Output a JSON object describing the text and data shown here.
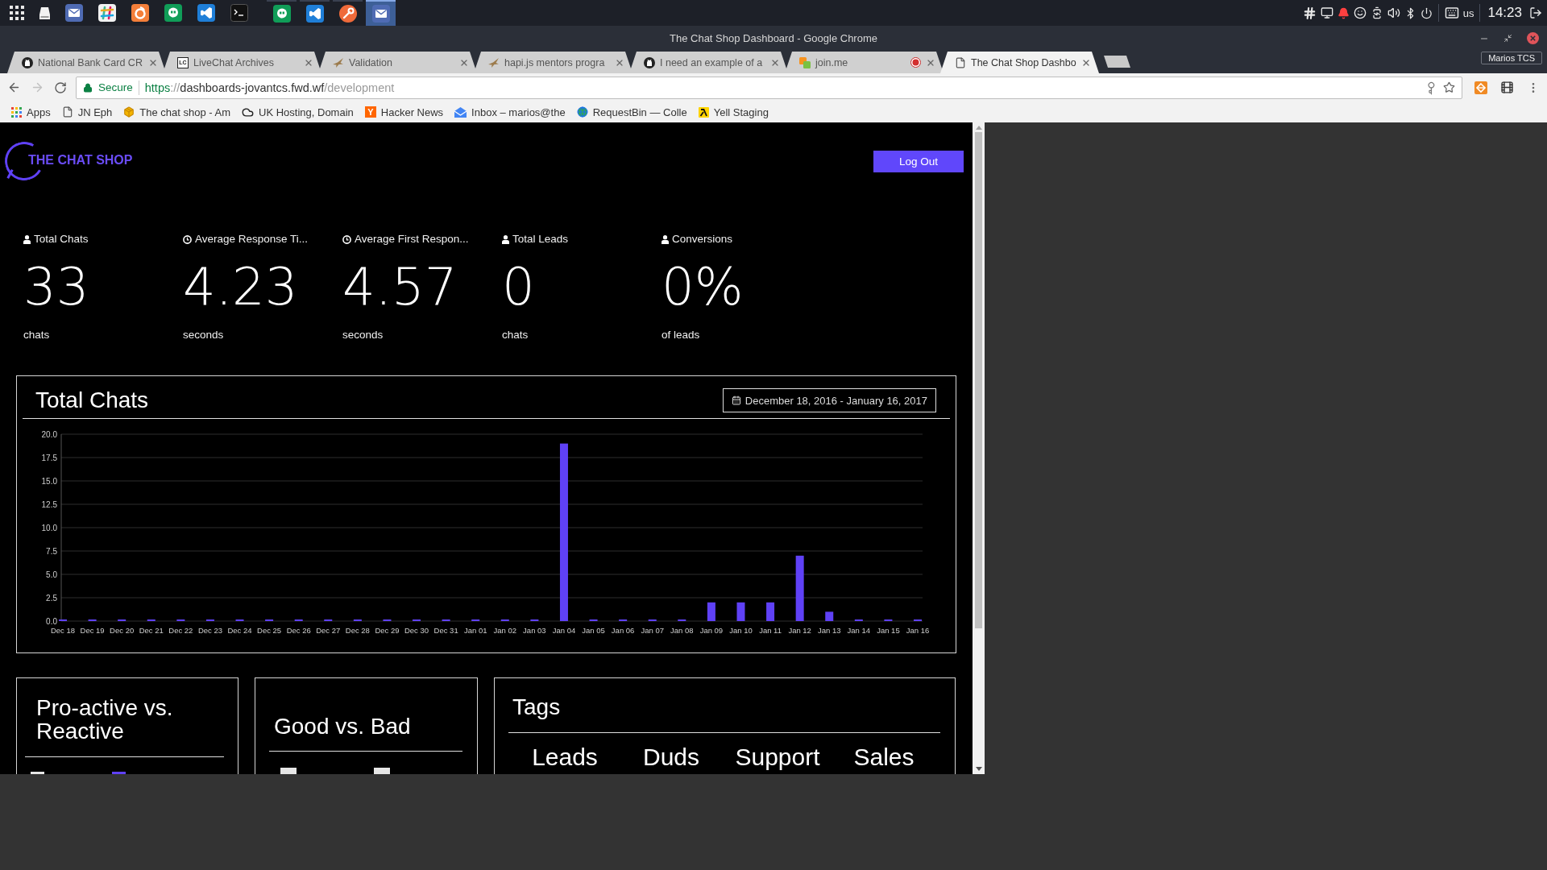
{
  "taskbar": {
    "pinned": [
      {
        "kind": "mail"
      },
      {
        "kind": "hash"
      },
      {
        "kind": "flame"
      },
      {
        "kind": "chat"
      },
      {
        "kind": "code"
      },
      {
        "kind": "terminal"
      }
    ],
    "windows": [
      {
        "kind": "chat",
        "selected": false
      },
      {
        "kind": "code",
        "selected": false
      },
      {
        "kind": "wrench",
        "selected": false
      },
      {
        "kind": "mail",
        "selected": true
      }
    ],
    "keyboard_layout": "us",
    "clock": "14:23"
  },
  "window": {
    "title": "The Chat Shop Dashboard - Google Chrome",
    "profile": "Marios TCS"
  },
  "tabs": [
    {
      "title": "National Bank Card CR",
      "kind": "round",
      "selected": false,
      "recording": false
    },
    {
      "title": "LiveChat Archives",
      "kind": "letter",
      "icon_text": "LC",
      "selected": false,
      "recording": false
    },
    {
      "title": "Validation",
      "kind": "bird",
      "selected": false,
      "recording": false
    },
    {
      "title": "hapi.js mentors progra",
      "kind": "bird",
      "selected": false,
      "recording": false
    },
    {
      "title": "I need an example of a",
      "kind": "round",
      "selected": false,
      "recording": false
    },
    {
      "title": "join.me",
      "kind": "squares",
      "selected": false,
      "recording": true
    },
    {
      "title": "The Chat Shop Dashbo",
      "kind": "page",
      "selected": true,
      "recording": false
    }
  ],
  "toolbar": {
    "back_disabled": false,
    "forward_disabled": true
  },
  "address_bar": {
    "security": "Secure",
    "scheme": "https",
    "separator": "://",
    "host": "dashboards-jovantcs.fwd.wf",
    "path": "/development",
    "bookmarked": false
  },
  "bookmarks": [
    {
      "label": "Apps",
      "kind": "apps"
    },
    {
      "label": "JN Eph",
      "kind": "page"
    },
    {
      "label": "The chat shop - Am",
      "kind": "box"
    },
    {
      "label": "UK Hosting, Domain",
      "kind": "cloud"
    },
    {
      "label": "Hacker News",
      "kind": "letter",
      "icon_text": "Y"
    },
    {
      "label": "Inbox – marios@the",
      "kind": "inbox"
    },
    {
      "label": "RequestBin — Colle",
      "kind": "globe"
    },
    {
      "label": "Yell Staging",
      "kind": "tile"
    }
  ],
  "page": {
    "brand": "THE CHAT SHOP",
    "logout": "Log Out",
    "stats": [
      {
        "kind": "count",
        "label": "Total Chats",
        "value": "33",
        "unit": "chats"
      },
      {
        "kind": "time",
        "label": "Average Response Ti...",
        "value": "4.23",
        "unit": "seconds"
      },
      {
        "kind": "time",
        "label": "Average First Respon...",
        "value": "4.57",
        "unit": "seconds"
      },
      {
        "kind": "count",
        "label": "Total Leads",
        "value": "0",
        "unit": "chats"
      },
      {
        "kind": "count",
        "label": "Conversions",
        "value": "0%",
        "unit": "of leads"
      }
    ],
    "total_chats": {
      "title": "Total Chats",
      "date_range": "December 18, 2016 - January 16, 2017",
      "chart_data": {
        "type": "bar",
        "categories": [
          "Dec 18",
          "Dec 19",
          "Dec 20",
          "Dec 21",
          "Dec 22",
          "Dec 23",
          "Dec 24",
          "Dec 25",
          "Dec 26",
          "Dec 27",
          "Dec 28",
          "Dec 29",
          "Dec 30",
          "Dec 31",
          "Jan 01",
          "Jan 02",
          "Jan 03",
          "Jan 04",
          "Jan 05",
          "Jan 06",
          "Jan 07",
          "Jan 08",
          "Jan 09",
          "Jan 10",
          "Jan 11",
          "Jan 12",
          "Jan 13",
          "Jan 14",
          "Jan 15",
          "Jan 16"
        ],
        "values": [
          0,
          0,
          0,
          0,
          0,
          0,
          0,
          0,
          0,
          0,
          0,
          0,
          0,
          0,
          0,
          0,
          0,
          19,
          0,
          0,
          0,
          0,
          2,
          2,
          2,
          7,
          1,
          0,
          0,
          0
        ],
        "color": "#5f41f6",
        "ylim": [
          0,
          20
        ],
        "yticks": [
          {
            "value": 0,
            "label": "0.0"
          },
          {
            "value": 2.5,
            "label": "2.5"
          },
          {
            "value": 5,
            "label": "5.0"
          },
          {
            "value": 7.5,
            "label": "7.5"
          },
          {
            "value": 10,
            "label": "10.0"
          },
          {
            "value": 12.5,
            "label": "12.5"
          },
          {
            "value": 15,
            "label": "15.0"
          },
          {
            "value": 17.5,
            "label": "17.5"
          },
          {
            "value": 20,
            "label": "20.0"
          }
        ],
        "grid": true
      }
    },
    "proactive_vs_reactive": {
      "title": "Pro-active vs. Reactive",
      "legend": [
        {
          "color": "#e6e6e6"
        },
        {
          "color": "#5f41f6"
        }
      ]
    },
    "good_vs_bad": {
      "title": "Good vs. Bad",
      "legend": [
        {
          "color": "#e6e6e6"
        },
        {
          "color": "#e6e6e6"
        }
      ]
    },
    "tags": {
      "title": "Tags",
      "columns": [
        "Leads",
        "Duds",
        "Support",
        "Sales"
      ]
    }
  }
}
